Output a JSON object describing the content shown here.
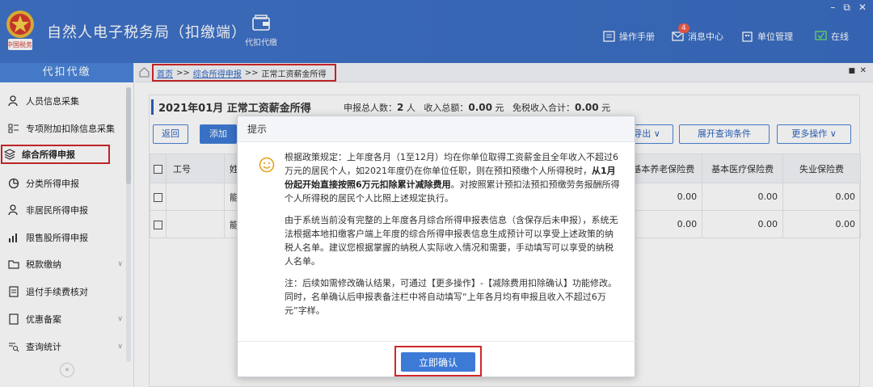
{
  "app": {
    "title": "自然人电子税务局（扣缴端）",
    "emblem_text": "中国税务",
    "tool_label": "代扣代缴",
    "links": {
      "manual": "操作手册",
      "messages": "消息中心",
      "messages_badge": "4",
      "unit": "单位管理",
      "online": "在线"
    },
    "window_controls": [
      "–",
      "⧉",
      "✕"
    ]
  },
  "sidebar": {
    "header": "代扣代缴",
    "items": [
      {
        "label": "人员信息采集",
        "icon": "person-icon"
      },
      {
        "label": "专项附加扣除信息采集",
        "icon": "list-icon"
      },
      {
        "label": "综合所得申报",
        "icon": "layers-icon",
        "active": true
      },
      {
        "label": "分类所得申报",
        "icon": "pie-icon"
      },
      {
        "label": "非居民所得申报",
        "icon": "person-icon"
      },
      {
        "label": "限售股所得申报",
        "icon": "bar-chart-icon"
      },
      {
        "label": "税款缴纳",
        "icon": "folder-icon",
        "expandable": true
      },
      {
        "label": "退付手续费核对",
        "icon": "doc-icon"
      },
      {
        "label": "优惠备案",
        "icon": "doc-icon",
        "expandable": true
      },
      {
        "label": "查询统计",
        "icon": "search-list-icon",
        "expandable": true
      }
    ],
    "collapse": "«"
  },
  "breadcrumb": {
    "home": "首页",
    "sep": ">>",
    "level1": "综合所得申报",
    "current": "正常工资薪金所得"
  },
  "main": {
    "title": "2021年01月  正常工资薪金所得",
    "summary": {
      "people_label": "申报总人数：",
      "people_value": "2",
      "people_unit": "人",
      "income_label": "收入总额：",
      "income_value": "0.00",
      "income_unit": "元",
      "exempt_label": "免税收入合计：",
      "exempt_value": "0.00",
      "exempt_unit": "元"
    },
    "buttons": {
      "back": "返回",
      "add": "添加",
      "export": "导出 ∨",
      "expand_query": "展开查询条件",
      "more": "更多操作 ∨"
    },
    "columns": [
      "工号",
      "姓",
      "基本养老保险费",
      "基本医疗保险费",
      "失业保险费"
    ],
    "rows": [
      {
        "name": "能",
        "pension": "0.00",
        "medical": "0.00",
        "unemployment": "0.00"
      },
      {
        "name": "能",
        "pension": "0.00",
        "medical": "0.00",
        "unemployment": "0.00"
      }
    ]
  },
  "dialog": {
    "title": "提示",
    "para1_a": "根据政策规定：上年度各月（1至12月）均在你单位取得工资薪金且全年收入不超过6万元的居民个人，如2021年度仍在你单位任职，则在预扣预缴个人所得税时，",
    "para1_b": "从1月份起开始直接按照6万元扣除累计减除费用",
    "para1_c": "。对按照累计预扣法预扣预缴劳务报酬所得个人所得税的居民个人比照上述规定执行。",
    "para2": "由于系统当前没有完整的上年度各月综合所得申报表信息（含保存后未申报），系统无法根据本地扣缴客户端上年度的综合所得申报表信息生成预计可以享受上述政策的纳税人名单。建议您根据掌握的纳税人实际收入情况和需要，手动填写可以享受的纳税人名单。",
    "para3": "注：后续如需修改确认结果，可通过【更多操作】-【减除费用扣除确认】功能修改。同时，名单确认后申报表备注栏中将自动填写“上年各月均有申报且收入不超过6万元”字样。",
    "confirm": "立即确认"
  }
}
